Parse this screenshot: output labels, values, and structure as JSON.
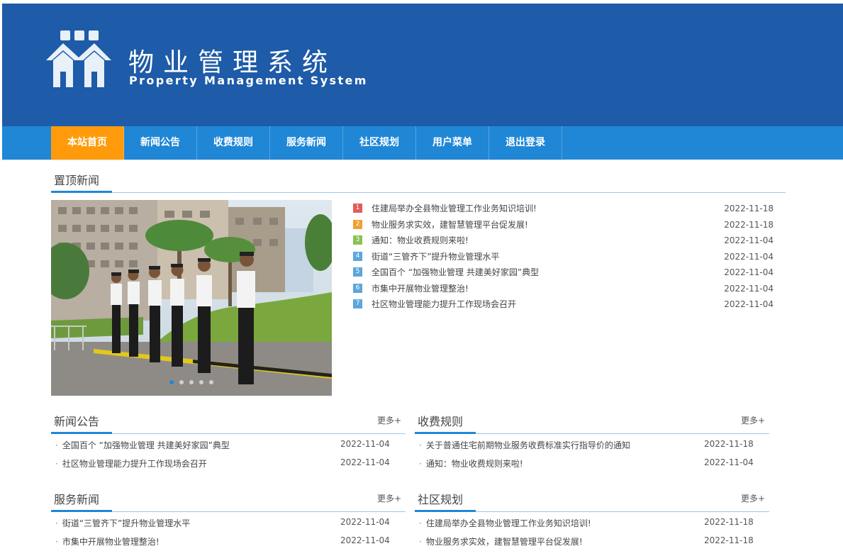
{
  "header": {
    "title_cn": "物业管理系统",
    "title_en": "Property Management System"
  },
  "nav": [
    {
      "label": "本站首页",
      "active": true
    },
    {
      "label": "新闻公告",
      "active": false
    },
    {
      "label": "收费规则",
      "active": false
    },
    {
      "label": "服务新闻",
      "active": false
    },
    {
      "label": "社区规划",
      "active": false
    },
    {
      "label": "用户菜单",
      "active": false
    },
    {
      "label": "退出登录",
      "active": false
    }
  ],
  "top_news": {
    "title": "置顶新闻",
    "items": [
      {
        "num": "1",
        "color": "#e35b5b",
        "title": "住建局举办全县物业管理工作业务知识培训!",
        "date": "2022-11-18"
      },
      {
        "num": "2",
        "color": "#f0a030",
        "title": "物业服务求实效，建智慧管理平台促发展!",
        "date": "2022-11-18"
      },
      {
        "num": "3",
        "color": "#8cc152",
        "title": "通知：物业收费规则来啦!",
        "date": "2022-11-04"
      },
      {
        "num": "4",
        "color": "#5da6dc",
        "title": "街道“三管齐下”提升物业管理水平",
        "date": "2022-11-04"
      },
      {
        "num": "5",
        "color": "#5da6dc",
        "title": "全国百个 “加强物业管理 共建美好家园”典型",
        "date": "2022-11-04"
      },
      {
        "num": "6",
        "color": "#5da6dc",
        "title": "市集中开展物业管理整治!",
        "date": "2022-11-04"
      },
      {
        "num": "7",
        "color": "#5da6dc",
        "title": "社区物业管理能力提升工作现场会召开",
        "date": "2022-11-04"
      }
    ]
  },
  "carousel": {
    "slides": 5,
    "active": 1
  },
  "more_label": "更多+",
  "sections": {
    "news": {
      "title": "新闻公告",
      "items": [
        {
          "title": "全国百个 “加强物业管理 共建美好家园”典型",
          "date": "2022-11-04"
        },
        {
          "title": "社区物业管理能力提升工作现场会召开",
          "date": "2022-11-04"
        }
      ]
    },
    "fees": {
      "title": "收费规则",
      "items": [
        {
          "title": "关于普通住宅前期物业服务收费标准实行指导价的通知",
          "date": "2022-11-18"
        },
        {
          "title": "通知：物业收费规则来啦!",
          "date": "2022-11-04"
        }
      ]
    },
    "service": {
      "title": "服务新闻",
      "items": [
        {
          "title": "街道“三管齐下”提升物业管理水平",
          "date": "2022-11-04"
        },
        {
          "title": "市集中开展物业管理整治!",
          "date": "2022-11-04"
        }
      ]
    },
    "community": {
      "title": "社区规划",
      "items": [
        {
          "title": "住建局举办全县物业管理工作业务知识培训!",
          "date": "2022-11-18"
        },
        {
          "title": "物业服务求实效，建智慧管理平台促发展!",
          "date": "2022-11-18"
        }
      ]
    }
  }
}
